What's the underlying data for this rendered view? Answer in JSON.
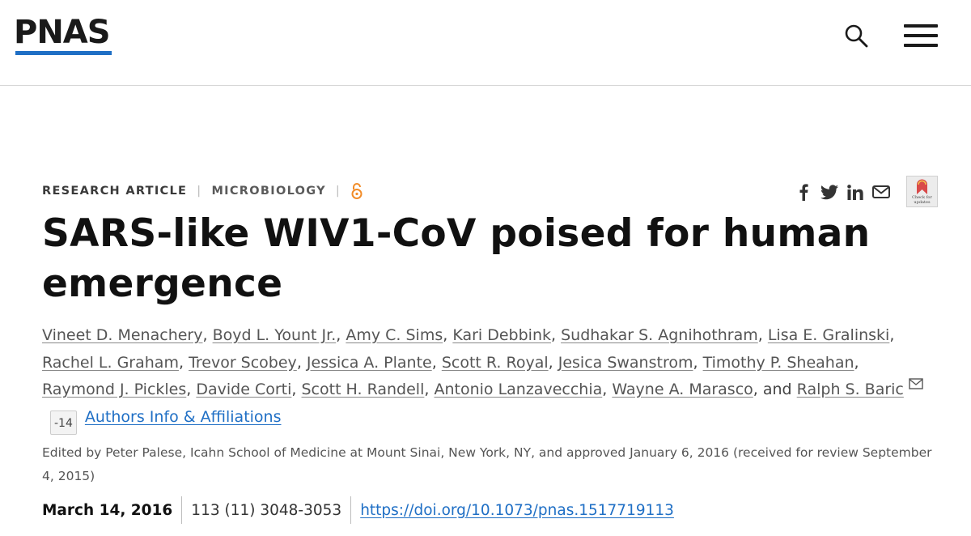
{
  "header": {
    "logo_text": "PNAS",
    "brand_color": "#1f6fc5",
    "search_icon": "search-icon",
    "menu_icon": "hamburger-menu-icon"
  },
  "meta": {
    "article_type": "RESEARCH ARTICLE",
    "subject": "MICROBIOLOGY",
    "open_access_icon": "open-access-icon"
  },
  "share": {
    "icons": [
      "facebook-icon",
      "twitter-icon",
      "linkedin-icon",
      "email-icon"
    ],
    "crossmark_text": "Check for updates"
  },
  "title": "SARS-like WIV1-CoV poised for human emergence",
  "authors": {
    "list": [
      "Vineet D. Menachery",
      "Boyd L. Yount Jr.",
      "Amy C. Sims",
      "Kari Debbink",
      "Sudhakar S. Agnihothram",
      "Lisa E. Gralinski",
      "Rachel L. Graham",
      "Trevor Scobey",
      "Jessica A. Plante",
      "Scott R. Royal",
      "Jesica Swanstrom",
      "Timothy P. Sheahan",
      "Raymond J. Pickles",
      "Davide Corti",
      "Scott H. Randell",
      "Antonio Lanzavecchia",
      "Wayne A. Marasco"
    ],
    "and": "and",
    "last": "Ralph S. Baric",
    "more_badge": "-14",
    "info_link": "Authors Info & Affiliations"
  },
  "edited": "Edited by Peter Palese, Icahn School of Medicine at Mount Sinai, New York, NY, and approved January 6, 2016 (received for review September 4, 2015)",
  "publication": {
    "date": "March 14, 2016",
    "citation": "113 (11) 3048-3053",
    "doi": "https://doi.org/10.1073/pnas.1517719113"
  }
}
